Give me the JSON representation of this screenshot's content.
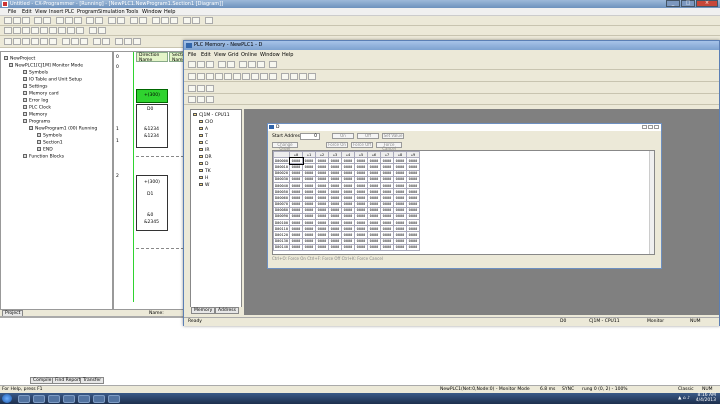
{
  "main": {
    "title": "Untitled - CX-Programmer - [Running] - [NewPLC1.NewProgram1.Section1 [Diagram]]",
    "menu": [
      "File",
      "Edit",
      "View",
      "Insert",
      "PLC",
      "Program",
      "Simulation",
      "Tools",
      "Window",
      "Help"
    ]
  },
  "tree": {
    "items": [
      {
        "label": "NewProject",
        "level": 0
      },
      {
        "label": "NewPLC1[CJ1M] Monitor Mode",
        "level": 1
      },
      {
        "label": "Symbols",
        "level": 2
      },
      {
        "label": "IO Table and Unit Setup",
        "level": 2
      },
      {
        "label": "Settings",
        "level": 2
      },
      {
        "label": "Memory card",
        "level": 2
      },
      {
        "label": "Error log",
        "level": 2
      },
      {
        "label": "PLC Clock",
        "level": 2
      },
      {
        "label": "Memory",
        "level": 2
      },
      {
        "label": "Programs",
        "level": 2
      },
      {
        "label": "NewProgram1 (00) Running",
        "level": 3
      },
      {
        "label": "Symbols",
        "level": 4
      },
      {
        "label": "Section1",
        "level": 4
      },
      {
        "label": "END",
        "level": 4
      },
      {
        "label": "Function Blocks",
        "level": 2
      }
    ],
    "tab": "Project"
  },
  "ladder": {
    "header1": "Direction Name",
    "header2": "Section Name",
    "rungs": [
      "0",
      "0",
      "1",
      "1",
      "2"
    ],
    "texts": [
      "+(300)",
      "D0",
      "&1234",
      "&1234",
      "+(300)",
      "D1",
      "&0",
      "&2345"
    ],
    "status_name": "Name:"
  },
  "memory": {
    "title": "PLC Memory - NewPLC1 - D",
    "menu": [
      "File",
      "Edit",
      "View",
      "Grid",
      "Online",
      "Window",
      "Help"
    ],
    "tree_root": "CJ1M - CPU11",
    "tree_items": [
      "CIO",
      "A",
      "T",
      "C",
      "IR",
      "DR",
      "D",
      "TK",
      "H",
      "W"
    ],
    "tree_tabs": [
      "Memory",
      "Address"
    ],
    "status_ready": "Ready",
    "status_cpu": "CJ1M - CPU11",
    "status_mode": "Monitor",
    "status_num": "NUM",
    "status_d": "D0"
  },
  "d_window": {
    "title": "D",
    "start_address_label": "Start Address",
    "start_address_value": "0",
    "buttons_row1": [
      "On",
      "Off",
      "Set Value"
    ],
    "buttons_row2": [
      "Change Order",
      "Force On",
      "Force Off",
      "Force Cancel"
    ],
    "col_headers": [
      "+0",
      "+1",
      "+2",
      "+3",
      "+4",
      "+5",
      "+6",
      "+7",
      "+8",
      "+9"
    ],
    "rows": [
      {
        "addr": "D00000",
        "vals": [
          "0000",
          "0000",
          "0000",
          "0000",
          "0000",
          "0000",
          "0000",
          "0000",
          "0000",
          "0000"
        ]
      },
      {
        "addr": "D00010",
        "vals": [
          "0000",
          "0000",
          "0000",
          "0000",
          "0000",
          "0000",
          "0000",
          "0000",
          "0000",
          "0000"
        ]
      },
      {
        "addr": "D00020",
        "vals": [
          "0000",
          "0000",
          "0000",
          "0000",
          "0000",
          "0000",
          "0000",
          "0000",
          "0000",
          "0000"
        ]
      },
      {
        "addr": "D00030",
        "vals": [
          "0000",
          "0000",
          "0000",
          "0000",
          "0000",
          "0000",
          "0000",
          "0000",
          "0000",
          "0000"
        ]
      },
      {
        "addr": "D00040",
        "vals": [
          "0000",
          "0000",
          "0000",
          "0000",
          "0000",
          "0000",
          "0000",
          "0000",
          "0000",
          "0000"
        ]
      },
      {
        "addr": "D00050",
        "vals": [
          "0000",
          "0000",
          "0000",
          "0000",
          "0000",
          "0000",
          "0000",
          "0000",
          "0000",
          "0000"
        ]
      },
      {
        "addr": "D00060",
        "vals": [
          "0000",
          "0000",
          "0000",
          "0000",
          "0000",
          "0000",
          "0000",
          "0000",
          "0000",
          "0000"
        ]
      },
      {
        "addr": "D00070",
        "vals": [
          "0000",
          "0000",
          "0000",
          "0000",
          "0000",
          "0000",
          "0000",
          "0000",
          "0000",
          "0000"
        ]
      },
      {
        "addr": "D00080",
        "vals": [
          "0000",
          "0000",
          "0000",
          "0000",
          "0000",
          "0000",
          "0000",
          "0000",
          "0000",
          "0000"
        ]
      },
      {
        "addr": "D00090",
        "vals": [
          "0000",
          "0000",
          "0000",
          "0000",
          "0000",
          "0000",
          "0000",
          "0000",
          "0000",
          "0000"
        ]
      },
      {
        "addr": "D00100",
        "vals": [
          "0000",
          "0000",
          "0000",
          "0000",
          "0000",
          "0000",
          "0000",
          "0000",
          "0000",
          "0000"
        ]
      },
      {
        "addr": "D00110",
        "vals": [
          "0000",
          "0000",
          "0000",
          "0000",
          "0000",
          "0000",
          "0000",
          "0000",
          "0000",
          "0000"
        ]
      },
      {
        "addr": "D00120",
        "vals": [
          "0000",
          "0000",
          "0000",
          "0000",
          "0000",
          "0000",
          "0000",
          "0000",
          "0000",
          "0000"
        ]
      },
      {
        "addr": "D00130",
        "vals": [
          "0000",
          "0000",
          "0000",
          "0000",
          "0000",
          "0000",
          "0000",
          "0000",
          "0000",
          "0000"
        ]
      },
      {
        "addr": "D00140",
        "vals": [
          "0000",
          "0000",
          "0000",
          "0000",
          "0000",
          "0000",
          "0000",
          "0000",
          "0000",
          "0000"
        ]
      }
    ],
    "footer": "Ctrl+O: Force On   Ctrl+F: Force Off   Ctrl+K: Force Cancel"
  },
  "output": {
    "tabs": [
      "Compile",
      "Find Report",
      "Transfer"
    ]
  },
  "status": {
    "help": "For Help, press F1",
    "plc": "NewPLC1(Net:0,Node:0) - Monitor Mode",
    "scan": "6.8 ms",
    "sync": "SYNC",
    "rung": "rung 0 (0, 2)  - 100%",
    "style": "Classic",
    "num": "NUM"
  },
  "taskbar": {
    "time": "8:16 AM",
    "date": "4/4/2013"
  }
}
